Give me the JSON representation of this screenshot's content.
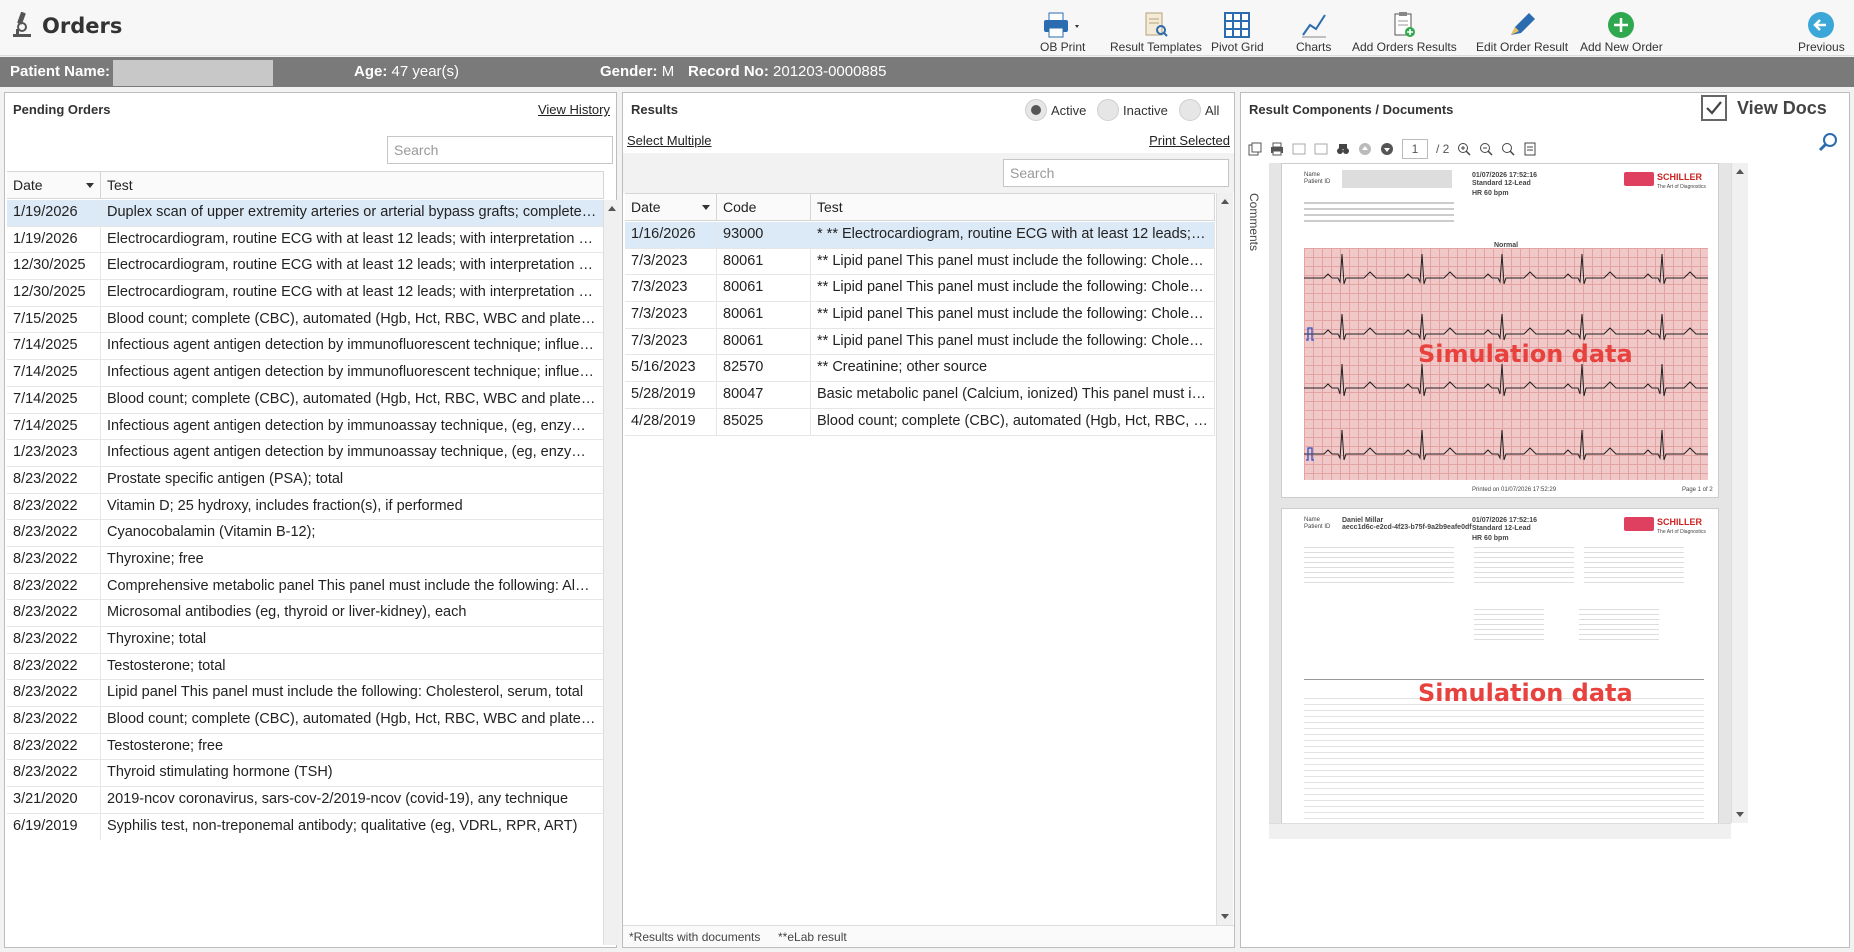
{
  "app": {
    "title": "Orders"
  },
  "toolbar": {
    "ob_print": "OB Print",
    "result_templates": "Result Templates",
    "pivot_grid": "Pivot Grid",
    "charts": "Charts",
    "add_orders_results": "Add Orders Results",
    "edit_order_result": "Edit Order Result",
    "add_new_order": "Add New Order",
    "previous": "Previous"
  },
  "patient": {
    "name_label": "Patient Name:",
    "age_label": "Age:",
    "age_value": "47 year(s)",
    "gender_label": "Gender:",
    "gender_value": "M",
    "record_label": "Record No:",
    "record_value": "201203-0000885"
  },
  "pending": {
    "title": "Pending Orders",
    "view_history": "View History",
    "search_placeholder": "Search",
    "col_date": "Date",
    "col_test": "Test",
    "rows": [
      {
        "date": "1/19/2026",
        "test": "Duplex scan of upper extremity arteries or arterial bypass grafts; complete bilateral study"
      },
      {
        "date": "1/19/2026",
        "test": "Electrocardiogram, routine ECG with at least 12 leads; with interpretation and report"
      },
      {
        "date": "12/30/2025",
        "test": "Electrocardiogram, routine ECG with at least 12 leads; with interpretation and report"
      },
      {
        "date": "12/30/2025",
        "test": "Electrocardiogram, routine ECG with at least 12 leads; with interpretation and report"
      },
      {
        "date": "7/15/2025",
        "test": "Blood count; complete (CBC), automated (Hgb, Hct, RBC, WBC and platelet count)"
      },
      {
        "date": "7/14/2025",
        "test": "Infectious agent antigen detection by immunofluorescent technique; influenza"
      },
      {
        "date": "7/14/2025",
        "test": "Infectious agent antigen detection by immunofluorescent technique; influenza"
      },
      {
        "date": "7/14/2025",
        "test": "Blood count; complete (CBC), automated (Hgb, Hct, RBC, WBC and platelet count)"
      },
      {
        "date": "7/14/2025",
        "test": "Infectious agent antigen detection by immunoassay technique, (eg, enzyme immunoassay)"
      },
      {
        "date": "1/23/2023",
        "test": "Infectious agent antigen detection by immunoassay technique, (eg, enzyme immunoassay)"
      },
      {
        "date": "8/23/2022",
        "test": "Prostate specific antigen (PSA); total"
      },
      {
        "date": "8/23/2022",
        "test": "Vitamin D; 25 hydroxy, includes fraction(s), if performed"
      },
      {
        "date": "8/23/2022",
        "test": "Cyanocobalamin (Vitamin B-12);"
      },
      {
        "date": "8/23/2022",
        "test": "Thyroxine; free"
      },
      {
        "date": "8/23/2022",
        "test": "Comprehensive metabolic panel This panel must include the following: Albumin"
      },
      {
        "date": "8/23/2022",
        "test": "Microsomal antibodies (eg, thyroid or liver-kidney), each"
      },
      {
        "date": "8/23/2022",
        "test": "Thyroxine; total"
      },
      {
        "date": "8/23/2022",
        "test": "Testosterone; total"
      },
      {
        "date": "8/23/2022",
        "test": "Lipid panel This panel must include the following: Cholesterol, serum, total"
      },
      {
        "date": "8/23/2022",
        "test": "Blood count; complete (CBC), automated (Hgb, Hct, RBC, WBC and platelet count)"
      },
      {
        "date": "8/23/2022",
        "test": "Testosterone; free"
      },
      {
        "date": "8/23/2022",
        "test": "Thyroid stimulating hormone (TSH)"
      },
      {
        "date": "3/21/2020",
        "test": "2019-ncov coronavirus, sars-cov-2/2019-ncov (covid-19), any technique"
      },
      {
        "date": "6/19/2019",
        "test": "Syphilis test, non-treponemal antibody; qualitative (eg, VDRL, RPR, ART)"
      }
    ]
  },
  "results": {
    "title": "Results",
    "radio_active": "Active",
    "radio_inactive": "Inactive",
    "radio_all": "All",
    "select_multiple": "Select Multiple",
    "print_selected": "Print Selected",
    "search_placeholder": "Search",
    "col_date": "Date",
    "col_code": "Code",
    "col_test": "Test",
    "rows": [
      {
        "date": "1/16/2026",
        "code": "93000",
        "test": "* ** Electrocardiogram, routine ECG with at least 12 leads; with interpretation"
      },
      {
        "date": "7/3/2023",
        "code": "80061",
        "test": "** Lipid panel This panel must include the following: Cholesterol"
      },
      {
        "date": "7/3/2023",
        "code": "80061",
        "test": "** Lipid panel This panel must include the following: Cholesterol"
      },
      {
        "date": "7/3/2023",
        "code": "80061",
        "test": "** Lipid panel This panel must include the following: Cholesterol"
      },
      {
        "date": "7/3/2023",
        "code": "80061",
        "test": "** Lipid panel This panel must include the following: Cholesterol"
      },
      {
        "date": "5/16/2023",
        "code": "82570",
        "test": "** Creatinine; other source"
      },
      {
        "date": "5/28/2019",
        "code": "80047",
        "test": "Basic metabolic panel (Calcium, ionized) This panel must include"
      },
      {
        "date": "4/28/2019",
        "code": "85025",
        "test": "Blood count; complete (CBC), automated (Hgb, Hct, RBC, WBC"
      }
    ],
    "footnote_docs": "*Results with documents",
    "footnote_elab": "**eLab result"
  },
  "components": {
    "title": "Result Components / Documents",
    "view_docs": "View Docs",
    "comments_tab": "Comments",
    "page_current": "1",
    "page_total": "/ 2",
    "page1": {
      "name_label": "Name",
      "patient_id_label": "Patient ID",
      "datetime": "01/07/2026 17:52:16",
      "ecg_type": "Standard 12-Lead",
      "hr": "HR   60 bpm",
      "brand": "SCHILLER",
      "brand_sub": "The Art of Diagnostics",
      "rhythm": "Normal",
      "watermark": "Simulation data",
      "footer": "Printed on 01/07/2026 17:52:29",
      "page": "Page 1 of 2"
    },
    "page2": {
      "name_label": "Name",
      "patient_name": "Daniel Millar",
      "patient_id_label": "Patient ID",
      "patient_id": "aecc1d6c-e2cd-4f23-b75f-9a2b9eafe0df",
      "datetime": "01/07/2026 17:52:16",
      "ecg_type": "Standard 12-Lead",
      "hr": "HR   60 bpm",
      "brand": "SCHILLER",
      "brand_sub": "The Art of Diagnostics",
      "watermark": "Simulation data"
    }
  }
}
